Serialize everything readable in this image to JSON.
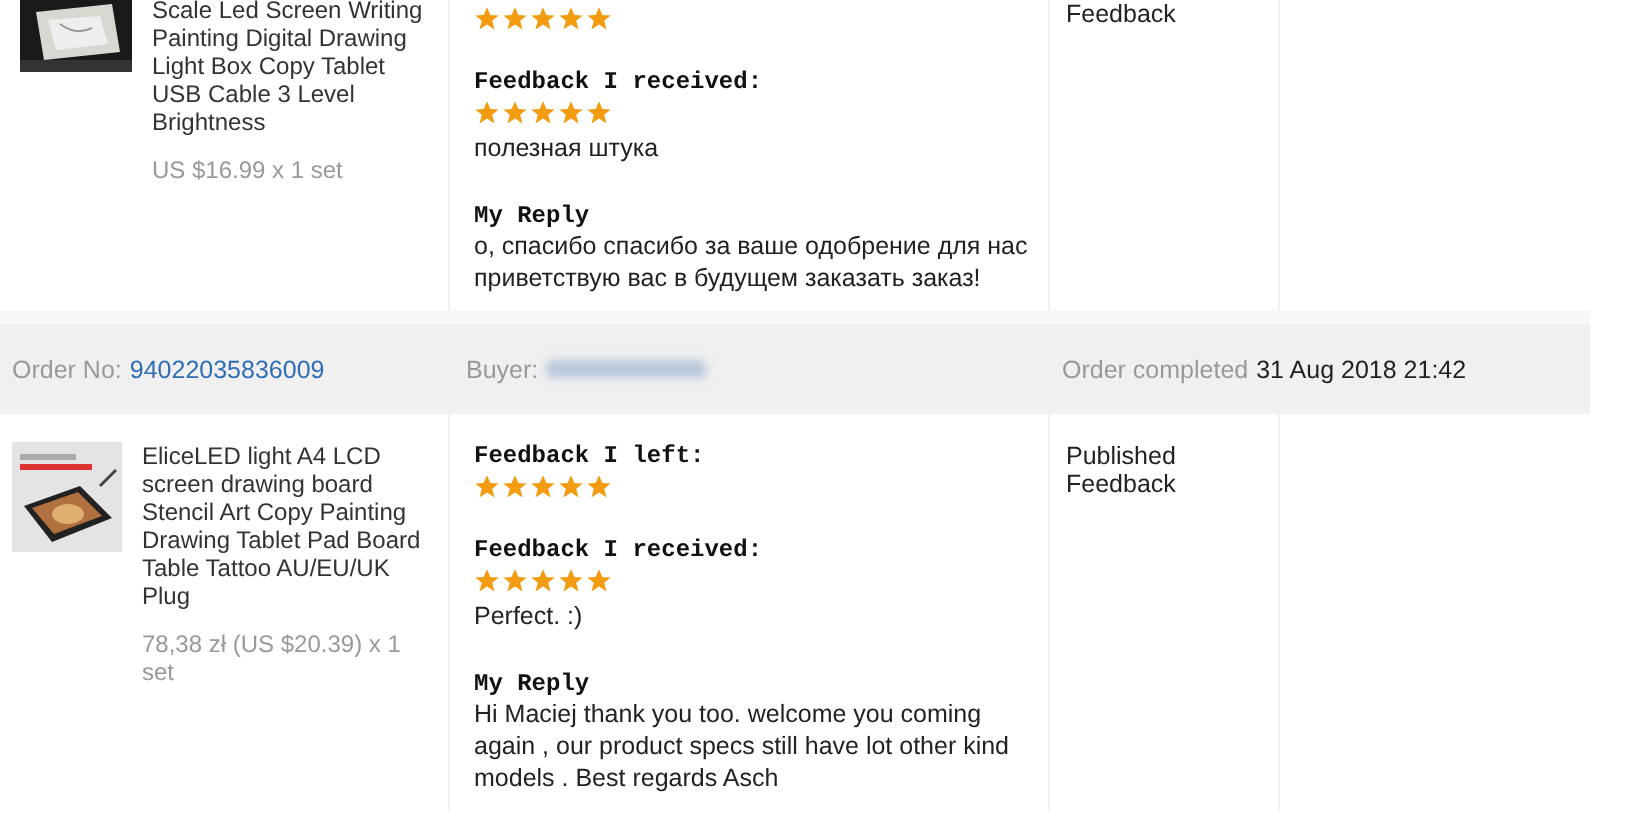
{
  "orders": [
    {
      "product": {
        "title": "Scale Led Screen Writing Painting Digital Drawing Light Box Copy Tablet USB Cable 3 Level Brightness",
        "price": "US $16.99 x 1 set"
      },
      "feedback_left": {
        "stars": 5
      },
      "feedback_received": {
        "label": "Feedback I received:",
        "stars": 5,
        "comment": "полезная штука"
      },
      "reply": {
        "label": "My Reply",
        "text": "о, спасибо спасибо за ваше одобрение для нас приветствую вас в будущем заказать заказ!"
      },
      "status": "Feedback"
    },
    {
      "header": {
        "order_label": "Order No:",
        "order_no": "94022035836009",
        "buyer_label": "Buyer:",
        "completed_label": "Order completed",
        "completed_date": "31 Aug 2018 21:42"
      },
      "product": {
        "title": "EliceLED light A4 LCD screen drawing board Stencil Art Copy Painting Drawing Tablet Pad Board Table Tattoo AU/EU/UK Plug",
        "price": "78,38 zł (US $20.39) x 1 set"
      },
      "feedback_left": {
        "label": "Feedback I left:",
        "stars": 5
      },
      "feedback_received": {
        "label": "Feedback I received:",
        "stars": 5,
        "comment": "Perfect. :)"
      },
      "reply": {
        "label": "My Reply",
        "text": "Hi Maciej thank you too. welcome you coming again , our product specs still have lot other kind models . Best regards Asch"
      },
      "status": "Published Feedback"
    }
  ]
}
